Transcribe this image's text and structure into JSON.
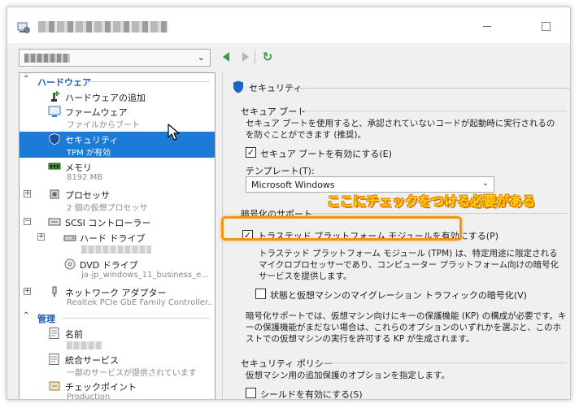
{
  "window": {
    "buttons": {
      "minimize_icon": "minimize-icon",
      "maximize_icon": "maximize-icon"
    }
  },
  "toolbar": {
    "prev_icon": "back-arrow-icon",
    "next_icon": "forward-arrow-icon",
    "refresh_icon": "refresh-icon"
  },
  "nav": {
    "hardware_section": "ハードウェア",
    "management_section": "管理",
    "hardware_items": [
      {
        "label": "ハードウェアの追加",
        "icon": "add-hardware-icon"
      },
      {
        "label": "ファームウェア",
        "sub": "ファイルからブート",
        "icon": "firmware-icon"
      },
      {
        "label": "セキュリティ",
        "sub": "TPM が有効",
        "icon": "shield-icon"
      },
      {
        "label": "メモリ",
        "sub": "8192 MB",
        "icon": "memory-icon"
      },
      {
        "label": "プロセッサ",
        "sub": "2 個の仮想プロセッサ",
        "icon": "processor-icon"
      },
      {
        "label": "SCSI コントローラー",
        "icon": "scsi-icon"
      },
      {
        "label": "ハード ドライブ",
        "icon": "hard-drive-icon"
      },
      {
        "label": "DVD ドライブ",
        "sub": "ja-jp_windows_11_business_e...",
        "icon": "dvd-icon"
      },
      {
        "label": "ネットワーク アダプター",
        "sub": "Realtek PCIe GbE Family Controller...",
        "icon": "network-adapter-icon"
      }
    ],
    "management_items": [
      {
        "label": "名前",
        "icon": "name-icon"
      },
      {
        "label": "統合サービス",
        "sub": "一部のサービスが提供されています",
        "icon": "integration-icon"
      },
      {
        "label": "チェックポイント",
        "sub": "Production",
        "icon": "checkpoint-icon"
      }
    ]
  },
  "detail": {
    "title": "セキュリティ",
    "secure_boot": {
      "group_title": "セキュア ブート",
      "description": "セキュア ブートを使用すると、承認されていないコードが起動時に実行されるのを防ぐことができます (推奨)。",
      "enable_label": "セキュア ブートを有効にする(E)",
      "enable_checked": true,
      "template_label": "テンプレート(T):",
      "template_value": "Microsoft Windows"
    },
    "encryption": {
      "group_title": "暗号化のサポート",
      "tpm_label": "トラステッド プラットフォーム モジュールを有効にする(P)",
      "tpm_checked": true,
      "tpm_description": "トラステッド プラットフォーム モジュール (TPM) は、特定用途に限定されるマイクロプロセッサーであり、コンピューター プラットフォーム向けの暗号化サービスを提供します。",
      "migration_label": "状態と仮想マシンのマイグレーション トラフィックの暗号化(V)",
      "migration_checked": false,
      "kp_note": "暗号化サポートでは、仮想マシン向けにキーの保護機能 (KP) の構成が必要です。キーの保護機能がまだない場合は、これらのオプションのいずれかを選ぶと、このホストでの仮想マシンの実行を許可する KP が生成されます。"
    },
    "security_policy": {
      "group_title": "セキュリティ ポリシー",
      "description": "仮想マシン用の追加保護のオプションを指定します。",
      "shield_label": "シールドを有効にする(S)",
      "shield_checked": false
    }
  },
  "annotation": {
    "text": "ここにチェックをつける必要がある",
    "color": "#ffd400",
    "box_color": "#f29414"
  },
  "colors": {
    "accent": "#1c7bd6",
    "section_header": "#1b5fb4",
    "nav_arrow": "#2ea043"
  }
}
